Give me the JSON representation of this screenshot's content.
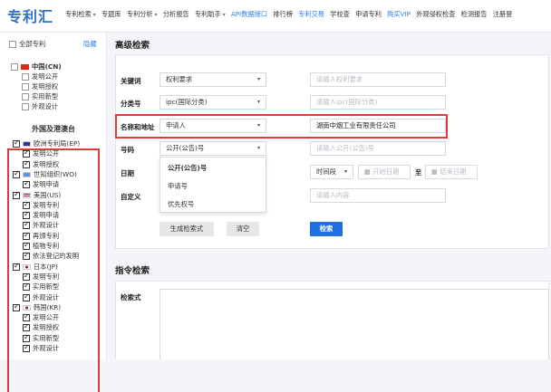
{
  "header": {
    "logo": "专利汇",
    "nav": [
      {
        "label": "专利检索",
        "dropdown": true,
        "blue": false
      },
      {
        "label": "专题库",
        "dropdown": false,
        "blue": false
      },
      {
        "label": "专利分析",
        "dropdown": true,
        "blue": false
      },
      {
        "label": "分析报告",
        "dropdown": false,
        "blue": false
      },
      {
        "label": "专利助手",
        "dropdown": true,
        "blue": false
      },
      {
        "label": "API数据接口",
        "dropdown": false,
        "blue": true
      },
      {
        "label": "排行榜",
        "dropdown": false,
        "blue": false
      },
      {
        "label": "专利交易",
        "dropdown": false,
        "blue": true
      },
      {
        "label": "学校查",
        "dropdown": false,
        "blue": false
      },
      {
        "label": "申请专利",
        "dropdown": false,
        "blue": false
      },
      {
        "label": "购买VIP",
        "dropdown": false,
        "blue": true
      },
      {
        "label": "外观侵权检查",
        "dropdown": false,
        "blue": false
      },
      {
        "label": "检测报告",
        "dropdown": false,
        "blue": false
      },
      {
        "label": "注册登",
        "dropdown": false,
        "blue": false
      }
    ]
  },
  "sidebar": {
    "all_label": "全部专利",
    "hide_label": "隐藏",
    "china_label": "中国(CN)",
    "china_items": [
      "发明公开",
      "发明授权",
      "实用新型",
      "外观设计"
    ],
    "foreign_title": "外国及港澳台",
    "ep_label": "欧洲专利局(EP)",
    "ep_items": [
      "发明公开",
      "发明授权"
    ],
    "wo_label": "世知组织(WO)",
    "wo_items": [
      "发明申请"
    ],
    "us_label": "美国(US)",
    "us_items": [
      "发明专利",
      "发明申请",
      "外观设计",
      "再颁专利",
      "植物专利",
      "依法登记的发明"
    ],
    "jp_label": "日本(JP)",
    "jp_items": [
      "发明专利",
      "实用新型",
      "外观设计"
    ],
    "kr_label": "韩国(KR)",
    "kr_items": [
      "发明公开",
      "发明授权",
      "实用新型",
      "外观设计"
    ]
  },
  "advanced": {
    "title": "高级检索",
    "rows": {
      "keyword": {
        "label": "关键词",
        "select": "权利要求",
        "placeholder": "请输入权利要求"
      },
      "class": {
        "label": "分类号",
        "select": "ipc(国际分类)",
        "placeholder": "请输入ipc(国际分类)"
      },
      "name": {
        "label": "名称和地址",
        "select": "申请人",
        "value": "湖南中烟工业有限责任公司"
      },
      "number": {
        "label": "号码",
        "select": "公开(公告)号",
        "placeholder": "请输入公开(公告)号"
      },
      "date": {
        "label": "日期",
        "select": "时间段",
        "start": "开始日期",
        "to": "至",
        "end": "结束日期"
      },
      "custom": {
        "label": "自定义",
        "placeholder": "请输入内容"
      }
    },
    "dropdown_options": [
      "公开(公告)号",
      "申请号",
      "优先权号"
    ],
    "buttons": {
      "generate": "生成检索式",
      "clear": "清空",
      "search": "检索"
    }
  },
  "command": {
    "title": "指令检索",
    "field_label": "检索式"
  },
  "colors": {
    "accent": "#1f6fe0",
    "highlight": "#e03b3b",
    "logo": "#2f6fc5"
  }
}
